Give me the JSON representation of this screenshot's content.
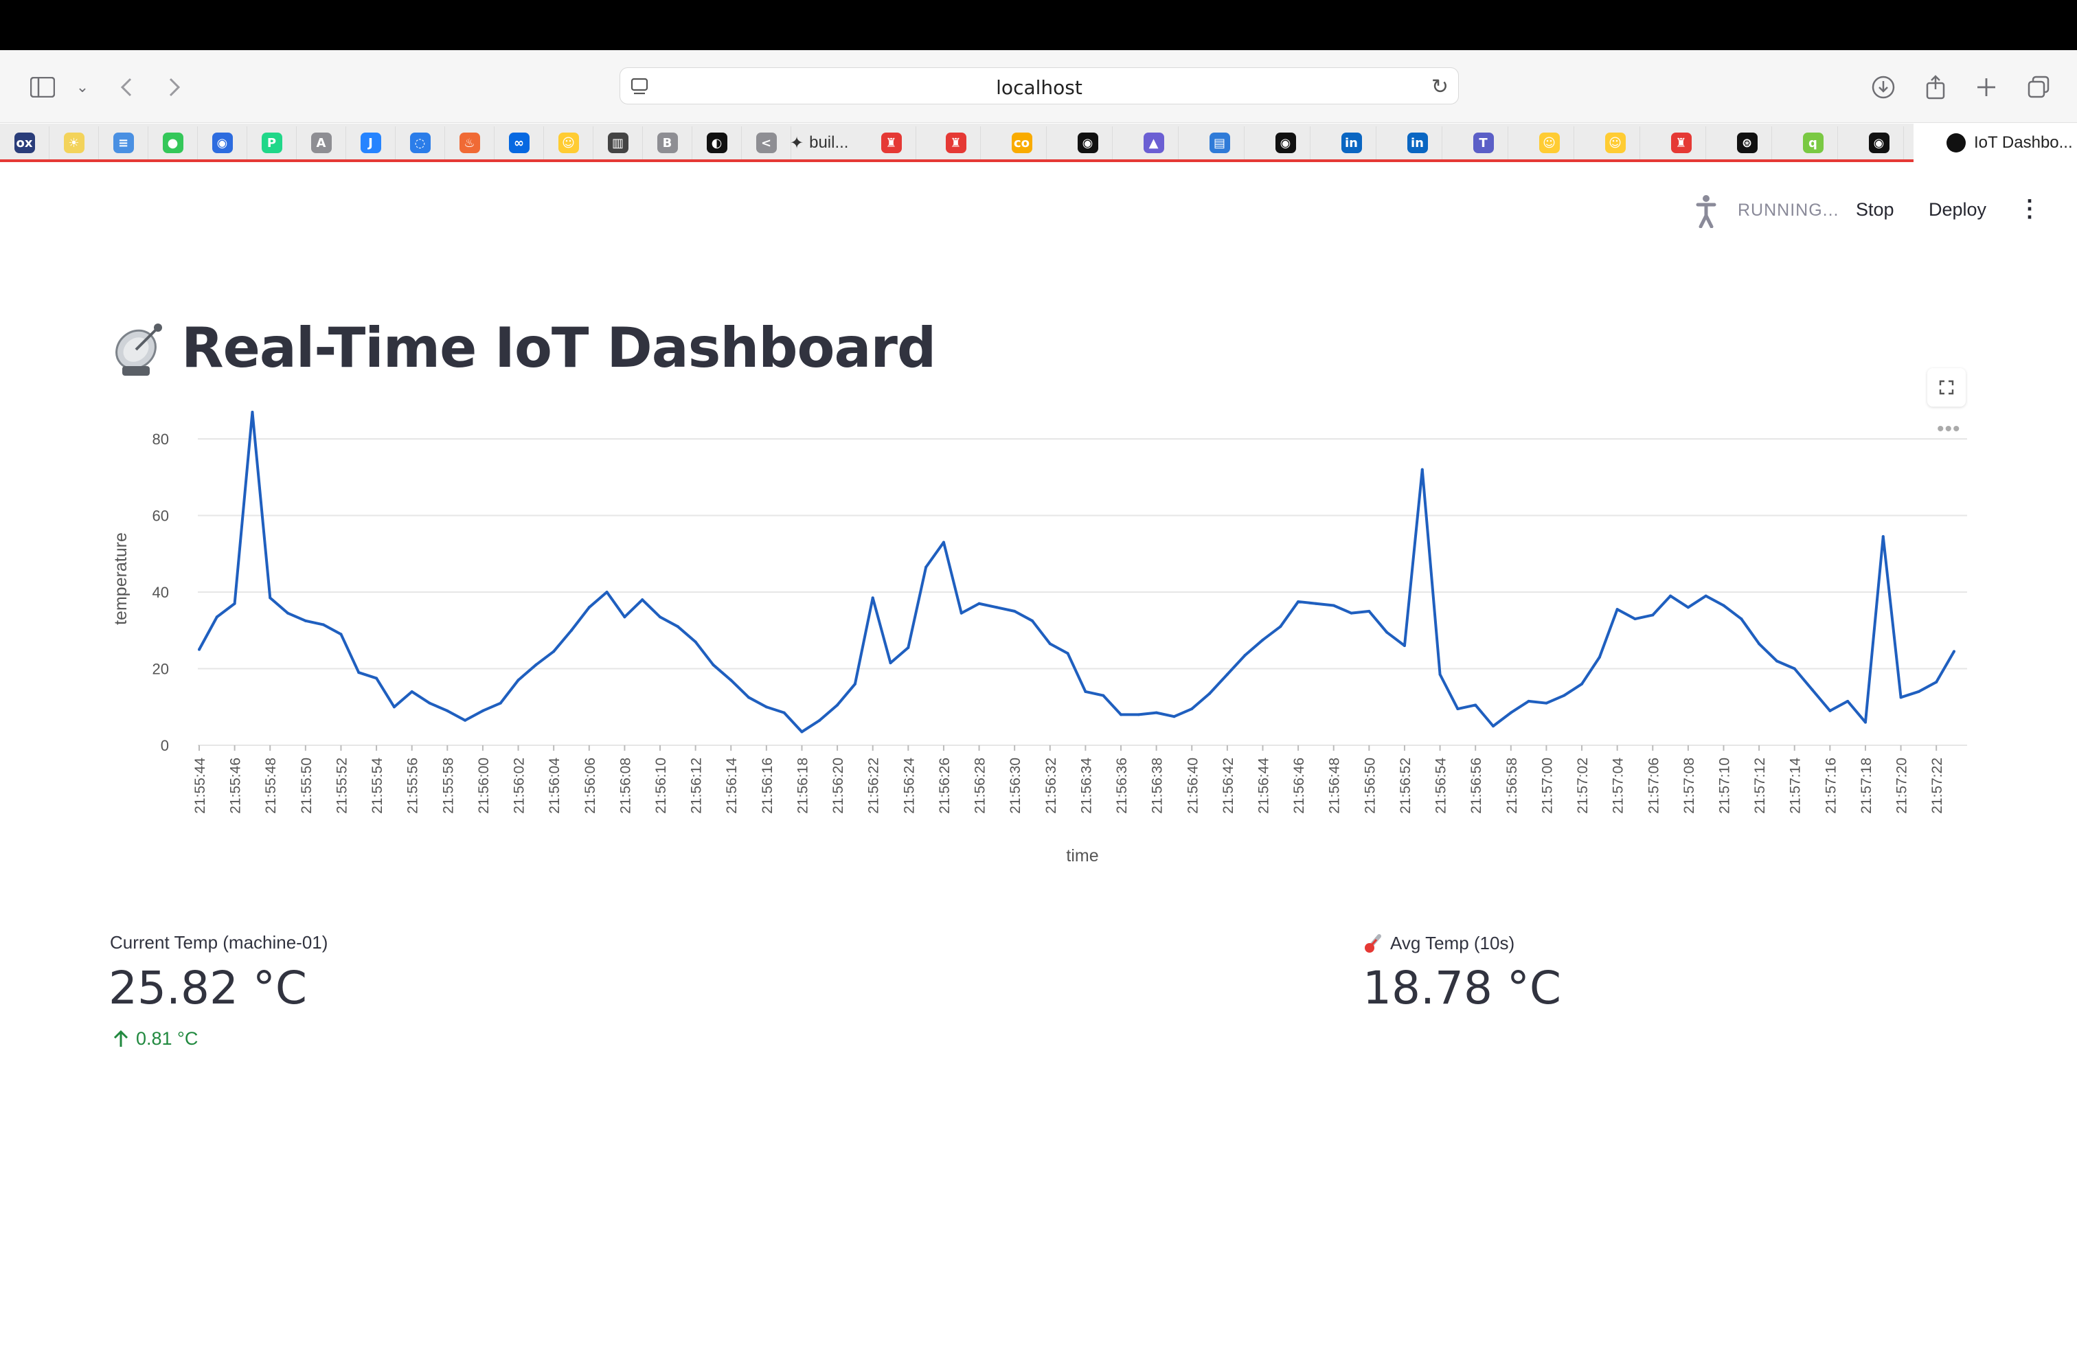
{
  "browser": {
    "url": "localhost",
    "bookmark_text": "buil...",
    "active_tab_title": "IoT Dashbo...",
    "bookmarks": [
      {
        "icon": "ox-icon",
        "glyph": "ox",
        "color": "#2a3d7a"
      },
      {
        "icon": "sun-icon",
        "glyph": "☀",
        "color": "#f3d35b"
      },
      {
        "icon": "list-icon",
        "glyph": "≡",
        "color": "#4a90e2"
      },
      {
        "icon": "green-dot-icon",
        "glyph": "●",
        "color": "#34c759"
      },
      {
        "icon": "bot-icon",
        "glyph": "◉",
        "color": "#2d6cdf"
      },
      {
        "icon": "pycharm-icon",
        "glyph": "P",
        "color": "#21d789"
      },
      {
        "icon": "a-icon",
        "glyph": "A",
        "color": "#8e8e93"
      },
      {
        "icon": "jira-icon",
        "glyph": "J",
        "color": "#2684ff"
      },
      {
        "icon": "ring-icon",
        "glyph": "◌",
        "color": "#2b7de9"
      },
      {
        "icon": "flame-icon",
        "glyph": "♨",
        "color": "#f06a35"
      },
      {
        "icon": "meta-icon",
        "glyph": "∞",
        "color": "#0668e1"
      },
      {
        "icon": "hugging-face-icon",
        "glyph": "☺",
        "color": "#ffcc33"
      },
      {
        "icon": "book-icon",
        "glyph": "▥",
        "color": "#444444"
      },
      {
        "icon": "b-icon",
        "glyph": "B",
        "color": "#8e8e93"
      },
      {
        "icon": "llama-icon",
        "glyph": "◐",
        "color": "#111111"
      },
      {
        "icon": "chevron-icon",
        "glyph": "<",
        "color": "#8e8e93"
      },
      {
        "icon": "sparkle-icon",
        "glyph": "✦",
        "color": "#111111"
      },
      {
        "icon": "streamlit-icon",
        "glyph": "♜",
        "color": "#e53935"
      },
      {
        "icon": "streamlit-icon",
        "glyph": "♜",
        "color": "#e53935"
      },
      {
        "icon": "colab-icon",
        "glyph": "co",
        "color": "#f9ab00"
      },
      {
        "icon": "github-icon",
        "glyph": "◉",
        "color": "#111111"
      },
      {
        "icon": "chart-icon",
        "glyph": "▲",
        "color": "#6b5fd3"
      },
      {
        "icon": "reader-icon",
        "glyph": "▤",
        "color": "#2f7bd8"
      },
      {
        "icon": "github-icon",
        "glyph": "◉",
        "color": "#111111"
      },
      {
        "icon": "linkedin-icon",
        "glyph": "in",
        "color": "#0a66c2"
      },
      {
        "icon": "linkedin-icon",
        "glyph": "in",
        "color": "#0a66c2"
      },
      {
        "icon": "teams-icon",
        "glyph": "T",
        "color": "#5b5fc7"
      },
      {
        "icon": "hugging-face-icon",
        "glyph": "☺",
        "color": "#ffcc33"
      },
      {
        "icon": "hugging-face-icon",
        "glyph": "☺",
        "color": "#ffcc33"
      },
      {
        "icon": "streamlit-icon",
        "glyph": "♜",
        "color": "#e53935"
      },
      {
        "icon": "openai-icon",
        "glyph": "⊛",
        "color": "#111111"
      },
      {
        "icon": "q-icon",
        "glyph": "q",
        "color": "#7ac943"
      },
      {
        "icon": "github-icon",
        "glyph": "◉",
        "color": "#111111"
      }
    ]
  },
  "header": {
    "status": "RUNNING...",
    "stop_label": "Stop",
    "deploy_label": "Deploy",
    "menu_icon": "kebab-menu-icon"
  },
  "page": {
    "title": "Real-Time IoT Dashboard",
    "title_icon": "satellite-dish-icon"
  },
  "chart_data": {
    "type": "line",
    "xlabel": "time",
    "ylabel": "temperature",
    "ylim": [
      0,
      87
    ],
    "yticks": [
      0,
      20,
      40,
      60,
      80
    ],
    "grid": true,
    "color": "#1f5fbf",
    "x": [
      "21:55:44",
      "21:55:45",
      "21:55:46",
      "21:55:47",
      "21:55:48",
      "21:55:49",
      "21:55:50",
      "21:55:51",
      "21:55:52",
      "21:55:53",
      "21:55:54",
      "21:55:55",
      "21:55:56",
      "21:55:57",
      "21:55:58",
      "21:55:59",
      "21:56:00",
      "21:56:01",
      "21:56:02",
      "21:56:03",
      "21:56:04",
      "21:56:05",
      "21:56:06",
      "21:56:07",
      "21:56:08",
      "21:56:09",
      "21:56:10",
      "21:56:11",
      "21:56:12",
      "21:56:13",
      "21:56:14",
      "21:56:15",
      "21:56:16",
      "21:56:17",
      "21:56:18",
      "21:56:19",
      "21:56:20",
      "21:56:21",
      "21:56:22",
      "21:56:23",
      "21:56:24",
      "21:56:25",
      "21:56:26",
      "21:56:27",
      "21:56:28",
      "21:56:29",
      "21:56:30",
      "21:56:31",
      "21:56:32",
      "21:56:33",
      "21:56:34",
      "21:56:35",
      "21:56:36",
      "21:56:37",
      "21:56:38",
      "21:56:39",
      "21:56:40",
      "21:56:41",
      "21:56:42",
      "21:56:43",
      "21:56:44",
      "21:56:45",
      "21:56:46",
      "21:56:47",
      "21:56:48",
      "21:56:49",
      "21:56:50",
      "21:56:51",
      "21:56:52",
      "21:56:53",
      "21:56:54",
      "21:56:55",
      "21:56:56",
      "21:56:57",
      "21:56:58",
      "21:56:59",
      "21:57:00",
      "21:57:01",
      "21:57:02",
      "21:57:03",
      "21:57:04",
      "21:57:05",
      "21:57:06",
      "21:57:07",
      "21:57:08",
      "21:57:09",
      "21:57:10",
      "21:57:11",
      "21:57:12",
      "21:57:13",
      "21:57:14",
      "21:57:15",
      "21:57:16",
      "21:57:17",
      "21:57:18",
      "21:57:19",
      "21:57:20",
      "21:57:21",
      "21:57:22",
      "21:57:23"
    ],
    "tick_labels": [
      "21:55:44",
      "21:55:46",
      "21:55:48",
      "21:55:50",
      "21:55:52",
      "21:55:54",
      "21:55:56",
      "21:55:58",
      "21:56:00",
      "21:56:02",
      "21:56:04",
      "21:56:06",
      "21:56:08",
      "21:56:10",
      "21:56:12",
      "21:56:14",
      "21:56:16",
      "21:56:18",
      "21:56:20",
      "21:56:22",
      "21:56:24",
      "21:56:26",
      "21:56:28",
      "21:56:30",
      "21:56:32",
      "21:56:34",
      "21:56:36",
      "21:56:38",
      "21:56:40",
      "21:56:42",
      "21:56:44",
      "21:56:46",
      "21:56:48",
      "21:56:50",
      "21:56:52",
      "21:56:54",
      "21:56:56",
      "21:56:58",
      "21:57:00",
      "21:57:02",
      "21:57:04",
      "21:57:06",
      "21:57:08",
      "21:57:10",
      "21:57:12",
      "21:57:14",
      "21:57:16",
      "21:57:18",
      "21:57:20",
      "21:57:22"
    ],
    "series": [
      {
        "values": [
          25,
          33.5,
          37,
          87,
          38.5,
          34.5,
          32.5,
          31.5,
          29,
          19,
          17.5,
          10,
          14,
          11,
          9,
          6.5,
          9,
          11,
          17,
          21,
          24.5,
          30,
          36,
          40,
          33.5,
          38,
          33.5,
          31,
          27,
          21,
          17,
          12.5,
          10,
          8.5,
          3.5,
          6.5,
          10.5,
          16,
          38.5,
          21.5,
          25.5,
          46.5,
          53,
          34.5,
          37,
          36,
          35,
          32.5,
          26.5,
          24,
          14,
          13,
          8,
          8,
          8.5,
          7.5,
          9.5,
          13.5,
          18.5,
          23.5,
          27.5,
          31,
          37.5,
          37,
          36.5,
          34.5,
          35,
          29.5,
          26,
          72,
          18.5,
          9.5,
          10.5,
          5,
          8.5,
          11.5,
          11,
          13,
          16,
          23,
          35.5,
          33,
          34,
          39,
          36,
          39,
          36.5,
          33,
          26.5,
          22,
          20,
          14.5,
          9,
          11.5,
          6,
          54.5,
          12.5,
          14,
          16.5,
          24.5
        ]
      }
    ]
  },
  "metrics": {
    "current": {
      "label": "Current Temp (machine-01)",
      "value": "25.82 °C",
      "delta": "0.81 °C",
      "delta_icon": "arrow-up-icon",
      "delta_color": "#21893f"
    },
    "average": {
      "label": "Avg Temp (10s)",
      "label_icon": "thermometer-icon",
      "value": "18.78 °C"
    }
  }
}
